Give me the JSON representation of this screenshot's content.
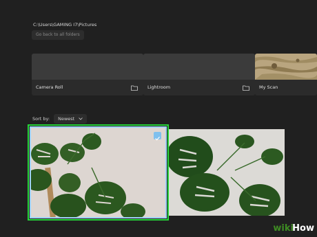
{
  "breadcrumb": {
    "path": "C:\\Users\\GAMING I7\\Pictures"
  },
  "toolbar": {
    "back_label": "Go back to all folders"
  },
  "folders": [
    {
      "label": "Camera Roll",
      "icon": "folder-icon"
    },
    {
      "label": "Lightroom",
      "icon": "folder-icon"
    },
    {
      "label": "My Scan",
      "icon": "folder-icon"
    }
  ],
  "sort": {
    "label": "Sort by:",
    "value": "Newest"
  },
  "photos": [
    {
      "selected": true
    },
    {
      "selected": false
    }
  ],
  "watermark": {
    "wiki": "wiki",
    "how": "How"
  },
  "colors": {
    "background": "#202020",
    "selection_outer": "#26d43a",
    "selection_inner": "#9ed0f4",
    "checkbox": "#7fc0ee"
  }
}
